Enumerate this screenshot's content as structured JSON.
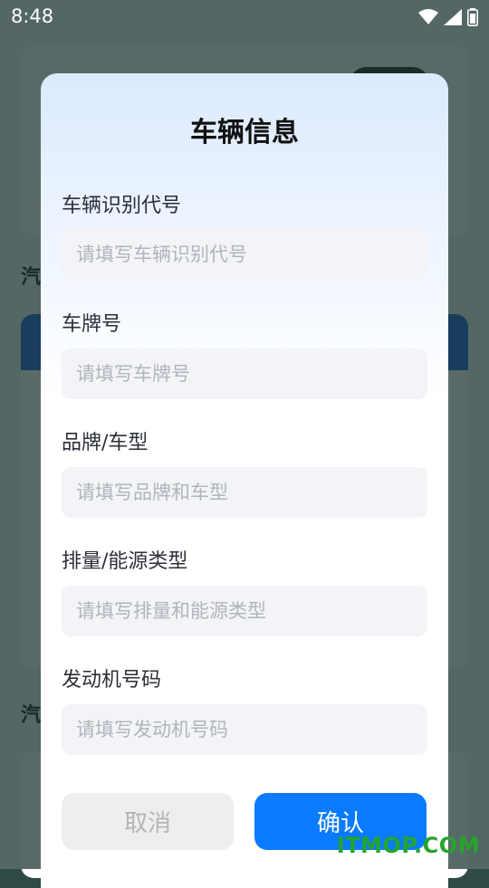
{
  "status_bar": {
    "time": "8:48",
    "icons": [
      "wifi-icon",
      "signal-icon",
      "battery-icon"
    ]
  },
  "background": {
    "section_title_1": "汽",
    "section_title_2": "汽"
  },
  "dialog": {
    "title": "车辆信息",
    "fields": [
      {
        "label": "车辆识别代号",
        "placeholder": "请填写车辆识别代号",
        "value": ""
      },
      {
        "label": "车牌号",
        "placeholder": "请填写车牌号",
        "value": ""
      },
      {
        "label": "品牌/车型",
        "placeholder": "请填写品牌和车型",
        "value": ""
      },
      {
        "label": "排量/能源类型",
        "placeholder": "请填写排量和能源类型",
        "value": ""
      },
      {
        "label": "发动机号码",
        "placeholder": "请填写发动机号码",
        "value": ""
      }
    ],
    "cancel_label": "取消",
    "confirm_label": "确认"
  },
  "watermark": "ITMOP.COM",
  "colors": {
    "accent": "#0a7bff",
    "input_bg": "#f3f4f8",
    "placeholder": "#b1b4bc",
    "cancel_bg": "#eeeeee",
    "watermark": "#25a52b"
  }
}
